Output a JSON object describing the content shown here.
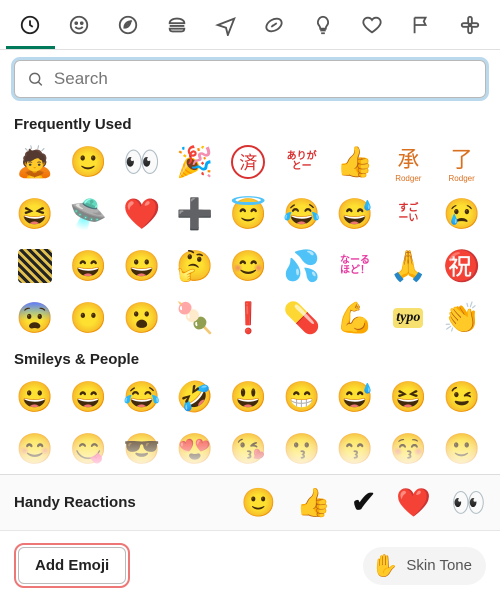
{
  "tabs": [
    {
      "name": "recent",
      "active": true
    },
    {
      "name": "smileys",
      "active": false
    },
    {
      "name": "nature",
      "active": false
    },
    {
      "name": "food",
      "active": false
    },
    {
      "name": "travel",
      "active": false
    },
    {
      "name": "activities",
      "active": false
    },
    {
      "name": "objects",
      "active": false
    },
    {
      "name": "symbols",
      "active": false
    },
    {
      "name": "flags",
      "active": false
    },
    {
      "name": "custom",
      "active": false
    }
  ],
  "search": {
    "placeholder": "Search",
    "value": ""
  },
  "sections": {
    "frequent": {
      "title": "Frequently Used",
      "items": [
        {
          "name": "bow",
          "glyph": "🙇"
        },
        {
          "name": "slightly-smiling",
          "glyph": "🙂"
        },
        {
          "name": "eyes",
          "glyph": "👀"
        },
        {
          "name": "tada",
          "glyph": "🎉"
        },
        {
          "name": "hanko-sumi",
          "glyph": "済",
          "custom": "hanko"
        },
        {
          "name": "arigatou",
          "glyph": "ありが\nとー",
          "custom": "text-red"
        },
        {
          "name": "thumbs-up",
          "glyph": "👍"
        },
        {
          "name": "shou-rodger",
          "glyph": "承\nRodger",
          "custom": "text-orange-stack"
        },
        {
          "name": "ryou-rodger",
          "glyph": "了\nRodger",
          "custom": "text-orange-stack"
        },
        {
          "name": "grin-squint",
          "glyph": "😆"
        },
        {
          "name": "ufo",
          "glyph": "🛸"
        },
        {
          "name": "red-heart",
          "glyph": "❤️"
        },
        {
          "name": "plus",
          "glyph": "➕"
        },
        {
          "name": "innocent",
          "glyph": "😇"
        },
        {
          "name": "joy",
          "glyph": "😂"
        },
        {
          "name": "sweat-smile",
          "glyph": "😅"
        },
        {
          "name": "sugoi",
          "glyph": "すご\nーい",
          "custom": "text-red"
        },
        {
          "name": "cry",
          "glyph": "😢"
        },
        {
          "name": "pattern",
          "glyph": "",
          "custom": "sumi"
        },
        {
          "name": "smile",
          "glyph": "😄"
        },
        {
          "name": "grin",
          "glyph": "😀"
        },
        {
          "name": "thinking",
          "glyph": "🤔"
        },
        {
          "name": "blush",
          "glyph": "😊"
        },
        {
          "name": "sweat-drops",
          "glyph": "💦"
        },
        {
          "name": "naruhodo",
          "glyph": "なーる\nほど！",
          "custom": "text-pink"
        },
        {
          "name": "pray",
          "glyph": "🙏"
        },
        {
          "name": "iwai",
          "glyph": "㊗️"
        },
        {
          "name": "scream-cold",
          "glyph": "😨"
        },
        {
          "name": "neutral",
          "glyph": "😶"
        },
        {
          "name": "open-mouth",
          "glyph": "😮"
        },
        {
          "name": "dango",
          "glyph": "🍡"
        },
        {
          "name": "exclamation",
          "glyph": "❗"
        },
        {
          "name": "pill",
          "glyph": "💊"
        },
        {
          "name": "flex",
          "glyph": "💪"
        },
        {
          "name": "typo",
          "glyph": "typo",
          "custom": "typo"
        },
        {
          "name": "clap",
          "glyph": "👏"
        }
      ]
    },
    "smileys": {
      "title": "Smileys & People",
      "items_row1": [
        {
          "name": "grinning",
          "glyph": "😀"
        },
        {
          "name": "smile",
          "glyph": "😄"
        },
        {
          "name": "joy",
          "glyph": "😂"
        },
        {
          "name": "rofl",
          "glyph": "🤣"
        },
        {
          "name": "grin",
          "glyph": "😃"
        },
        {
          "name": "big-grin",
          "glyph": "😁"
        },
        {
          "name": "sweat-smile",
          "glyph": "😅"
        },
        {
          "name": "laugh",
          "glyph": "😆"
        },
        {
          "name": "wink",
          "glyph": "😉"
        }
      ],
      "items_row2": [
        {
          "name": "blush",
          "glyph": "😊"
        },
        {
          "name": "yum",
          "glyph": "😋"
        },
        {
          "name": "sunglasses",
          "glyph": "😎"
        },
        {
          "name": "heart-eyes",
          "glyph": "😍"
        },
        {
          "name": "kissing-heart",
          "glyph": "😘"
        },
        {
          "name": "kissing",
          "glyph": "😗"
        },
        {
          "name": "kissing-smiling",
          "glyph": "😙"
        },
        {
          "name": "kissing-closed",
          "glyph": "😚"
        },
        {
          "name": "slightly-smiling",
          "glyph": "🙂"
        }
      ]
    }
  },
  "handy": {
    "title": "Handy Reactions",
    "items": [
      {
        "name": "slightly-smiling",
        "glyph": "🙂"
      },
      {
        "name": "thumbs-up",
        "glyph": "👍"
      },
      {
        "name": "check",
        "glyph": "✔",
        "custom": "check"
      },
      {
        "name": "red-heart",
        "glyph": "❤️"
      },
      {
        "name": "eyes",
        "glyph": "👀"
      }
    ]
  },
  "footer": {
    "add_label": "Add Emoji",
    "skin_tone_label": "Skin Tone",
    "skin_tone_hand": "✋"
  }
}
